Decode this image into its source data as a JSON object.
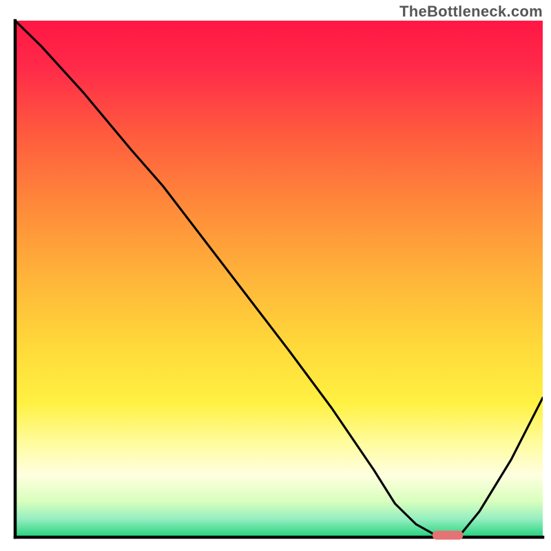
{
  "watermark": "TheBottleneck.com",
  "chart_data": {
    "type": "line",
    "title": "",
    "xlabel": "",
    "ylabel": "",
    "xlim": [
      0,
      100
    ],
    "ylim": [
      0,
      100
    ],
    "grid": false,
    "legend": false,
    "gradient_stops": [
      {
        "offset": 0.0,
        "color": "#ff1744"
      },
      {
        "offset": 0.09,
        "color": "#ff2a49"
      },
      {
        "offset": 0.22,
        "color": "#ff5b3e"
      },
      {
        "offset": 0.36,
        "color": "#ff8a3a"
      },
      {
        "offset": 0.5,
        "color": "#ffb53a"
      },
      {
        "offset": 0.63,
        "color": "#ffd93a"
      },
      {
        "offset": 0.74,
        "color": "#fff142"
      },
      {
        "offset": 0.82,
        "color": "#fffca0"
      },
      {
        "offset": 0.88,
        "color": "#ffffe0"
      },
      {
        "offset": 0.93,
        "color": "#d9ffbd"
      },
      {
        "offset": 0.965,
        "color": "#94eec0"
      },
      {
        "offset": 1.0,
        "color": "#23d27b"
      }
    ],
    "series": [
      {
        "name": "bottleneck-curve",
        "color": "#000000",
        "x": [
          0.0,
          5.0,
          13.0,
          22.0,
          28.0,
          40.0,
          52.0,
          60.0,
          68.0,
          72.0,
          76.0,
          79.0,
          80.0,
          84.0,
          88.0,
          94.0,
          100.0
        ],
        "values": [
          100.0,
          95.0,
          86.0,
          75.0,
          68.0,
          52.0,
          36.0,
          25.0,
          13.0,
          6.5,
          2.5,
          0.8,
          0.0,
          0.0,
          5.0,
          15.0,
          27.0
        ]
      }
    ],
    "marker": {
      "name": "optimum-marker",
      "x": 82,
      "y": 0,
      "width_pct": 5.8,
      "color": "#e57373"
    },
    "axes": {
      "color": "#000000",
      "width": 4.5
    }
  }
}
